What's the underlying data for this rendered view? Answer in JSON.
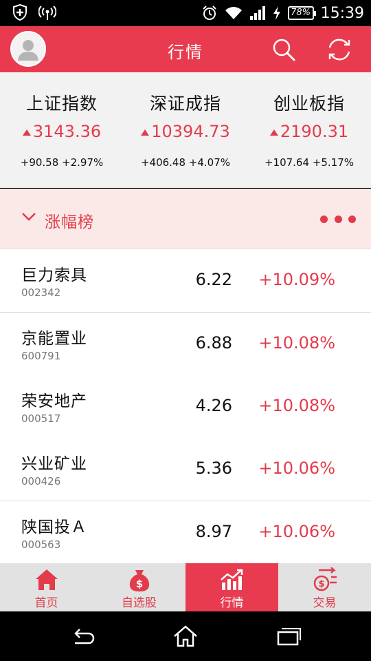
{
  "status_bar": {
    "time": "15:39",
    "battery": "78%",
    "icons": [
      "shield-plus-icon",
      "wireless-signal-icon",
      "alarm-clock-icon",
      "wifi-icon",
      "cell-signal-icon",
      "charging-bolt-icon"
    ]
  },
  "header": {
    "title": "行情",
    "icons": [
      "avatar-icon",
      "search-icon",
      "refresh-icon"
    ],
    "accent_color": "#e83b4f"
  },
  "indices": [
    {
      "name": "上证指数",
      "value": "3143.36",
      "change": "+90.58 +2.97%"
    },
    {
      "name": "深证成指",
      "value": "10394.73",
      "change": "+406.48 +4.07%"
    },
    {
      "name": "创业板指",
      "value": "2190.31",
      "change": "+107.64 +5.17%"
    }
  ],
  "ranking": {
    "title": "涨幅榜",
    "icons": [
      "chevron-down-icon",
      "more-dots-icon"
    ]
  },
  "stocks": [
    {
      "name": "巨力索具",
      "code": "002342",
      "price": "6.22",
      "change": "+10.09%"
    },
    {
      "name": "京能置业",
      "code": "600791",
      "price": "6.88",
      "change": "+10.08%"
    },
    {
      "name": "荣安地产",
      "code": "000517",
      "price": "4.26",
      "change": "+10.08%"
    },
    {
      "name": "兴业矿业",
      "code": "000426",
      "price": "5.36",
      "change": "+10.06%"
    },
    {
      "name": "陕国投Ａ",
      "code": "000563",
      "price": "8.97",
      "change": "+10.06%"
    }
  ],
  "tabs": [
    {
      "label": "首页",
      "icon": "home-icon",
      "active": false
    },
    {
      "label": "自选股",
      "icon": "money-bag-icon",
      "active": false
    },
    {
      "label": "行情",
      "icon": "trend-chart-icon",
      "active": true
    },
    {
      "label": "交易",
      "icon": "exchange-icon",
      "active": false
    }
  ],
  "nav_bar": {
    "icons": [
      "back-icon",
      "home-nav-icon",
      "recent-apps-icon"
    ]
  },
  "colors": {
    "up_red": "#e33b4b",
    "rank_bg": "#fbe9e7",
    "panel_bg": "#f2f2f2"
  }
}
